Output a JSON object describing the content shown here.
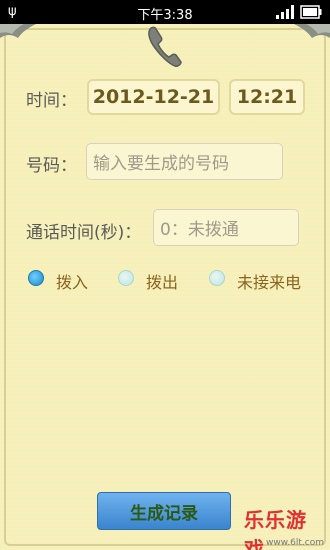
{
  "statusbar": {
    "time": "下午3:38"
  },
  "form": {
    "time_label": "时间：",
    "date_value": "2012-12-21",
    "clock_value": "12:21",
    "number_label": "号码：",
    "number_placeholder": "输入要生成的号码",
    "duration_label": "通话时间(秒)：",
    "duration_placeholder": "0：未拨通"
  },
  "call_types": [
    {
      "label": "拨入",
      "selected": true
    },
    {
      "label": "拨出",
      "selected": false
    },
    {
      "label": "未接来电",
      "selected": false
    }
  ],
  "generate_button": "生成记录",
  "watermark": {
    "text": "乐乐游戏",
    "url": "www.6lt.com"
  },
  "colors": {
    "background": "#f6f0b8",
    "accent": "#1e88c8",
    "button": "#3a85cf",
    "label": "#8a6420"
  }
}
